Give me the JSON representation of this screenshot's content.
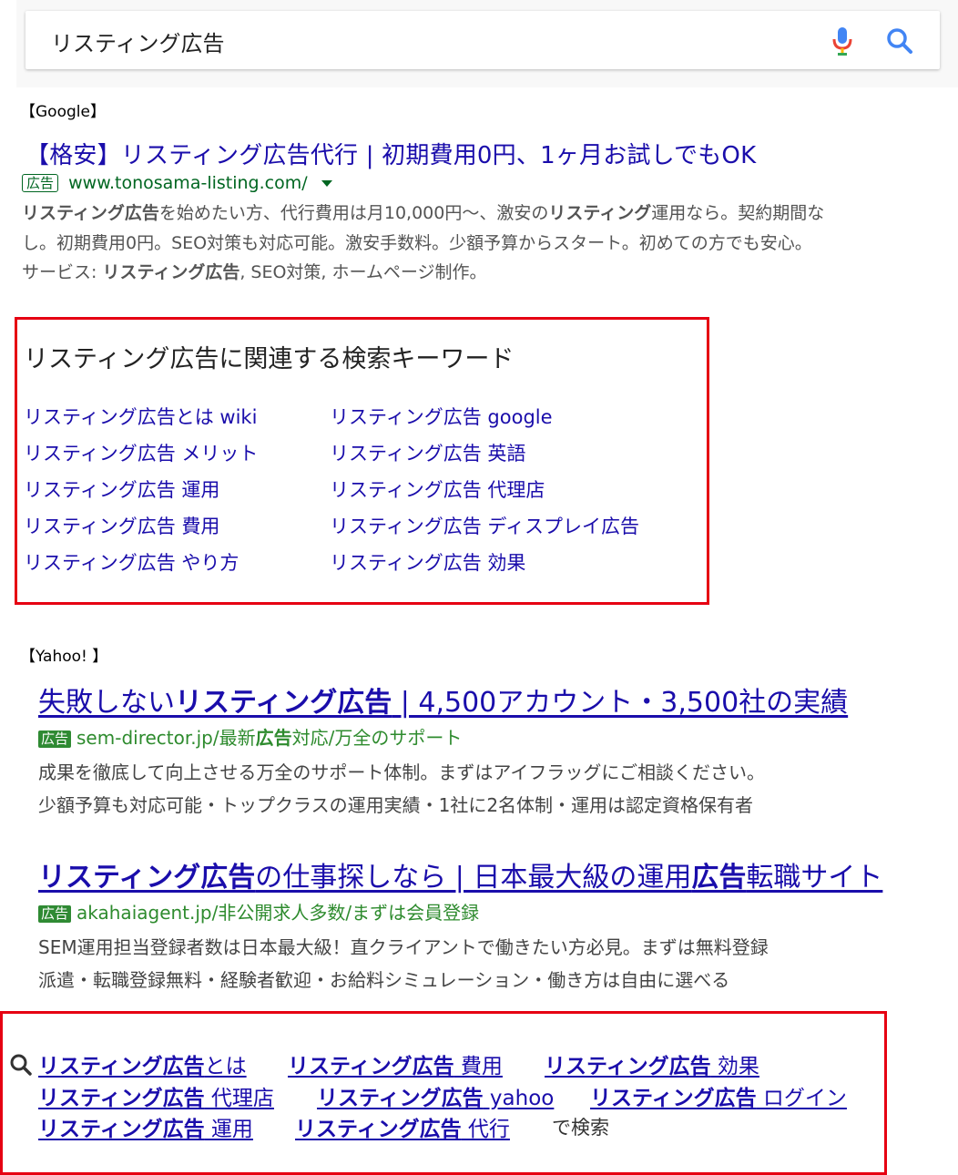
{
  "google_search": {
    "query": "リスティング広告",
    "mic_icon": "microphone-icon",
    "search_icon": "search-icon"
  },
  "google_section_label": "【Google】",
  "google_ad": {
    "title": "【格安】リスティング広告代行 | 初期費用0円、1ヶ月お試しでもOK",
    "badge": "広告",
    "url": "www.tonosama-listing.com/",
    "desc1_b1": "リスティング広告",
    "desc1_t1": "を始めたい方、代行費用は月10,000円〜、激安の",
    "desc1_b2": "リスティング",
    "desc1_t2": "運用なら。契約期間な",
    "desc2": "し。初期費用0円。SEO対策も対応可能。激安手数料。少額予算からスタート。初めての方でも安心。",
    "desc3_t1": "サービス: ",
    "desc3_b1": "リスティング広告",
    "desc3_t2": ", SEO対策, ホームページ制作。"
  },
  "google_related": {
    "heading": "リスティング広告に関連する検索キーワード",
    "left": [
      "リスティング広告とは wiki",
      "リスティング広告 メリット",
      "リスティング広告 運用",
      "リスティング広告 費用",
      "リスティング広告 やり方"
    ],
    "right": [
      "リスティング広告 google",
      "リスティング広告 英語",
      "リスティング広告 代理店",
      "リスティング広告 ディスプレイ広告",
      "リスティング広告 効果"
    ]
  },
  "yahoo_section_label": "【Yahoo! 】",
  "yahoo_ad1": {
    "title_t1": "失敗しない",
    "title_b1": "リスティング広告",
    "title_t2": " | 4,500アカウント・3,500社の実績",
    "badge": "広告",
    "url_t1": "sem-director.jp/最新",
    "url_b1": "広告",
    "url_t2": "対応/万全のサポート",
    "desc1": "成果を徹底して向上させる万全のサポート体制。まずはアイフラッグにご相談ください。",
    "desc2": "少額予算も対応可能・トップクラスの運用実績・1社に2名体制・運用は認定資格保有者"
  },
  "yahoo_ad2": {
    "title_b1": "リスティング広告",
    "title_t1": "の仕事探しなら | 日本最大級の運用",
    "title_b2": "広告",
    "title_t2": "転職サイト",
    "badge": "広告",
    "url": "akahaiagent.jp/非公開求人多数/まずは会員登録",
    "desc1": "SEM運用担当登録者数は日本最大級！直クライアントで働きたい方必見。まずは無料登録",
    "desc2": "派遣・転職登録無料・経験者歓迎・お給料シミュレーション・働き方は自由に選べる"
  },
  "yahoo_related": {
    "icon": "search-icon",
    "bold": "リスティング広告",
    "items": [
      {
        "suffix": "とは"
      },
      {
        "suffix": " 費用"
      },
      {
        "suffix": " 効果"
      },
      {
        "suffix": " 代理店"
      },
      {
        "suffix": " yahoo"
      },
      {
        "suffix": " ログイン"
      },
      {
        "suffix": " 運用"
      },
      {
        "suffix": " 代行"
      }
    ],
    "trailing": "で検索"
  },
  "colors": {
    "google_link": "#1a0dab",
    "google_url": "#006621",
    "red_box": "#e60012",
    "yahoo_badge": "#2f8a33"
  }
}
